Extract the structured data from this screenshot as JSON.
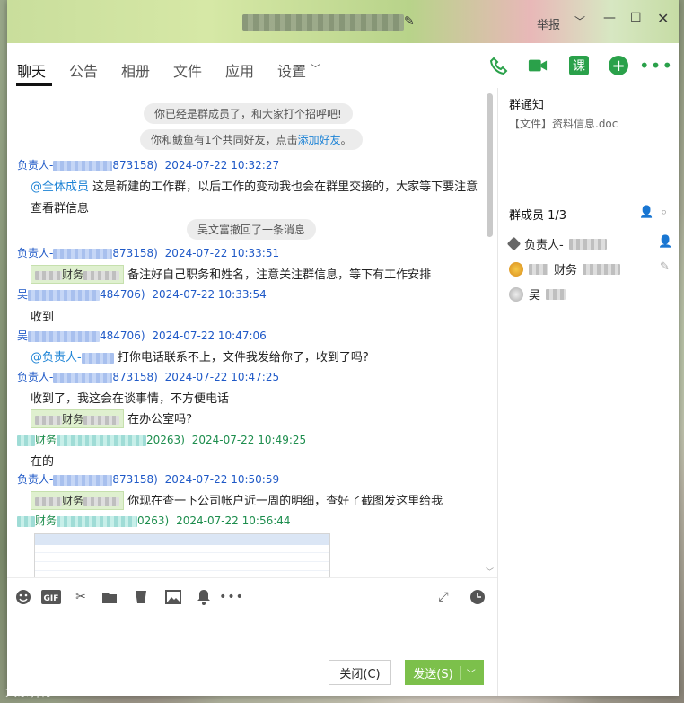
{
  "window": {
    "report": "举报"
  },
  "tabs": [
    {
      "label": "聊天"
    },
    {
      "label": "公告"
    },
    {
      "label": "相册"
    },
    {
      "label": "文件"
    },
    {
      "label": "应用"
    },
    {
      "label": "设置"
    }
  ],
  "actions": {
    "course": "课"
  },
  "chat": {
    "sys1": "你已经是群成员了，和大家打个招呼吧!",
    "sys2_pre": "你和鲅鱼有1个共同好友，点击",
    "sys2_link": "添加好友",
    "sys2_post": "。",
    "sys3": "吴文富撤回了一条消息",
    "messages": [
      {
        "name": "负责人-",
        "id": "873158)",
        "time": "2024-07-22 10:32:27",
        "mention": "@全体成员",
        "text": " 这是新建的工作群，以后工作的变动我也会在群里交接的，大家等下要注意",
        "text2": "查看群信息"
      },
      {
        "name": "负责人-",
        "id": "873158)",
        "time": "2024-07-22 10:33:51",
        "tag": "财务",
        "text": " 备注好自己职务和姓名，注意关注群信息，等下有工作安排"
      },
      {
        "name": "吴",
        "id": "484706)",
        "time": "2024-07-22 10:33:54",
        "text": "收到"
      },
      {
        "name": "吴",
        "id": "484706)",
        "time": "2024-07-22 10:47:06",
        "mention": "@负责人-",
        "text": " 打你电话联系不上，文件我发给你了，收到了吗?"
      },
      {
        "name": "负责人-",
        "id": "873158)",
        "time": "2024-07-22 10:47:25",
        "text": "收到了，我这会在谈事情，不方便电话",
        "tag2": "财务",
        "text2": " 在办公室吗?"
      },
      {
        "name": "财务",
        "id": "20263)",
        "time": "2024-07-22 10:49:25",
        "text": "在的"
      },
      {
        "name": "负责人-",
        "id": "873158)",
        "time": "2024-07-22 10:50:59",
        "tag": "财务",
        "text": " 你现在查一下公司帐户近一周的明细，查好了截图发这里给我"
      },
      {
        "name": "财务",
        "id": "0263)",
        "time": "2024-07-22 10:56:44"
      }
    ]
  },
  "right": {
    "notice_title": "群通知",
    "notice_file": "【文件】资料信息.doc",
    "members_title": "群成员 1/3",
    "members": [
      {
        "name": "负责人-"
      },
      {
        "name": "财务"
      },
      {
        "name": "吴"
      }
    ]
  },
  "buttons": {
    "close": "关闭(C)",
    "send": "发送(S)"
  },
  "watermark": "大象骑行"
}
